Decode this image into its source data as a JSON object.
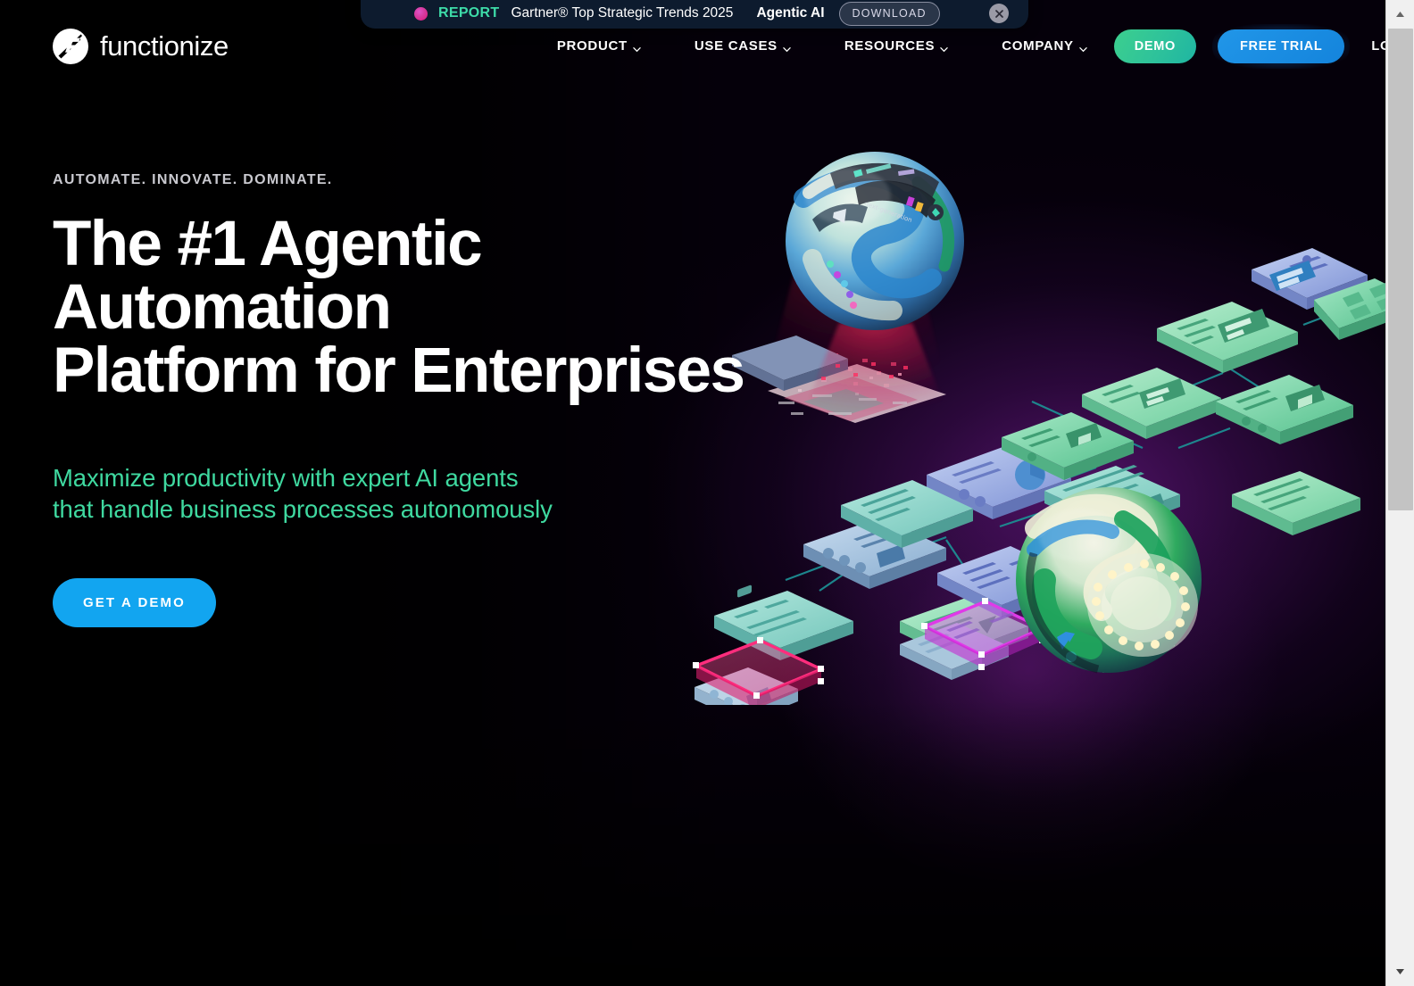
{
  "promo": {
    "dot_icon": "pink-dot-icon",
    "label": "REPORT",
    "title": "Gartner® Top Strategic Trends 2025",
    "tag": "Agentic AI",
    "download_label": "DOWNLOAD",
    "close_icon": "close-icon",
    "bg_color": "#0d1b2e",
    "label_color": "#3ddba8"
  },
  "header": {
    "logo_text": "functionize",
    "logo_icon": "functionize-logo-icon",
    "nav": [
      {
        "label": "PRODUCT",
        "icon": "chevron-down-icon"
      },
      {
        "label": "USE CASES",
        "icon": "chevron-down-icon"
      },
      {
        "label": "RESOURCES",
        "icon": "chevron-down-icon"
      },
      {
        "label": "COMPANY",
        "icon": "chevron-down-icon"
      }
    ],
    "demo_label": "DEMO",
    "free_trial_label": "FREE TRIAL",
    "login_label": "LOG IN",
    "demo_color": "#32c994",
    "trial_color": "#1c8fe2"
  },
  "hero": {
    "eyebrow": "AUTOMATE. INNOVATE. DOMINATE.",
    "heading_line1": "The #1 Agentic",
    "heading_line2": "Automation",
    "heading_line3": "Platform for Enterprises",
    "sub_line1": "Maximize productivity with expert AI agents",
    "sub_line2": "that handle business processes autonomously",
    "sub_color": "#3fd9a0",
    "cta_label": "GET A DEMO",
    "cta_color": "#12a5f0"
  },
  "illustration": {
    "name": "agentic-automation-network-illustration",
    "description": "Isometric network of workflow node cards connected by teal links, with two iridescent 3D spheres and a red light projection",
    "node_color_green": "#8fe0b8",
    "node_color_blue": "#9fb4e8",
    "node_color_teal": "#8fd8cf",
    "highlight_pink": "#ef2d7d",
    "highlight_magenta": "#d63ae0",
    "link_color": "#1d8d92"
  },
  "scrollbar": {
    "up_icon": "scroll-up-arrow-icon",
    "down_icon": "scroll-down-arrow-icon",
    "thumb": "scrollbar-thumb"
  }
}
